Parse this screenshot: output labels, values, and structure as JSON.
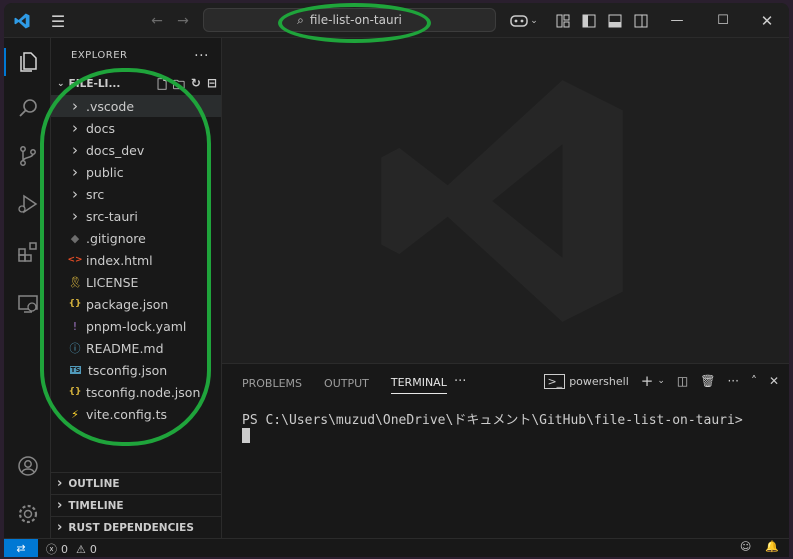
{
  "search": {
    "text": "file-list-on-tauri"
  },
  "sidebar": {
    "title": "EXPLORER",
    "project": "FILE-LI...",
    "items": [
      {
        "label": ".vscode",
        "type": "folder"
      },
      {
        "label": "docs",
        "type": "folder"
      },
      {
        "label": "docs_dev",
        "type": "folder"
      },
      {
        "label": "public",
        "type": "folder"
      },
      {
        "label": "src",
        "type": "folder"
      },
      {
        "label": "src-tauri",
        "type": "folder"
      },
      {
        "label": ".gitignore",
        "type": "git"
      },
      {
        "label": "index.html",
        "type": "html"
      },
      {
        "label": "LICENSE",
        "type": "license"
      },
      {
        "label": "package.json",
        "type": "json"
      },
      {
        "label": "pnpm-lock.yaml",
        "type": "yaml"
      },
      {
        "label": "README.md",
        "type": "info"
      },
      {
        "label": "tsconfig.json",
        "type": "ts"
      },
      {
        "label": "tsconfig.node.json",
        "type": "json"
      },
      {
        "label": "vite.config.ts",
        "type": "vite"
      }
    ],
    "panes": [
      "OUTLINE",
      "TIMELINE",
      "RUST DEPENDENCIES"
    ]
  },
  "panel": {
    "tabs": [
      "PROBLEMS",
      "OUTPUT",
      "TERMINAL"
    ],
    "active_tab": "TERMINAL",
    "shell": "powershell",
    "prompt": "PS C:\\Users\\muzud\\OneDrive\\ドキュメント\\GitHub\\file-list-on-tauri>"
  },
  "status": {
    "errors": "0",
    "warnings": "0"
  },
  "colors": {
    "accent": "#0078d4",
    "highlight": "#1fa43b"
  }
}
